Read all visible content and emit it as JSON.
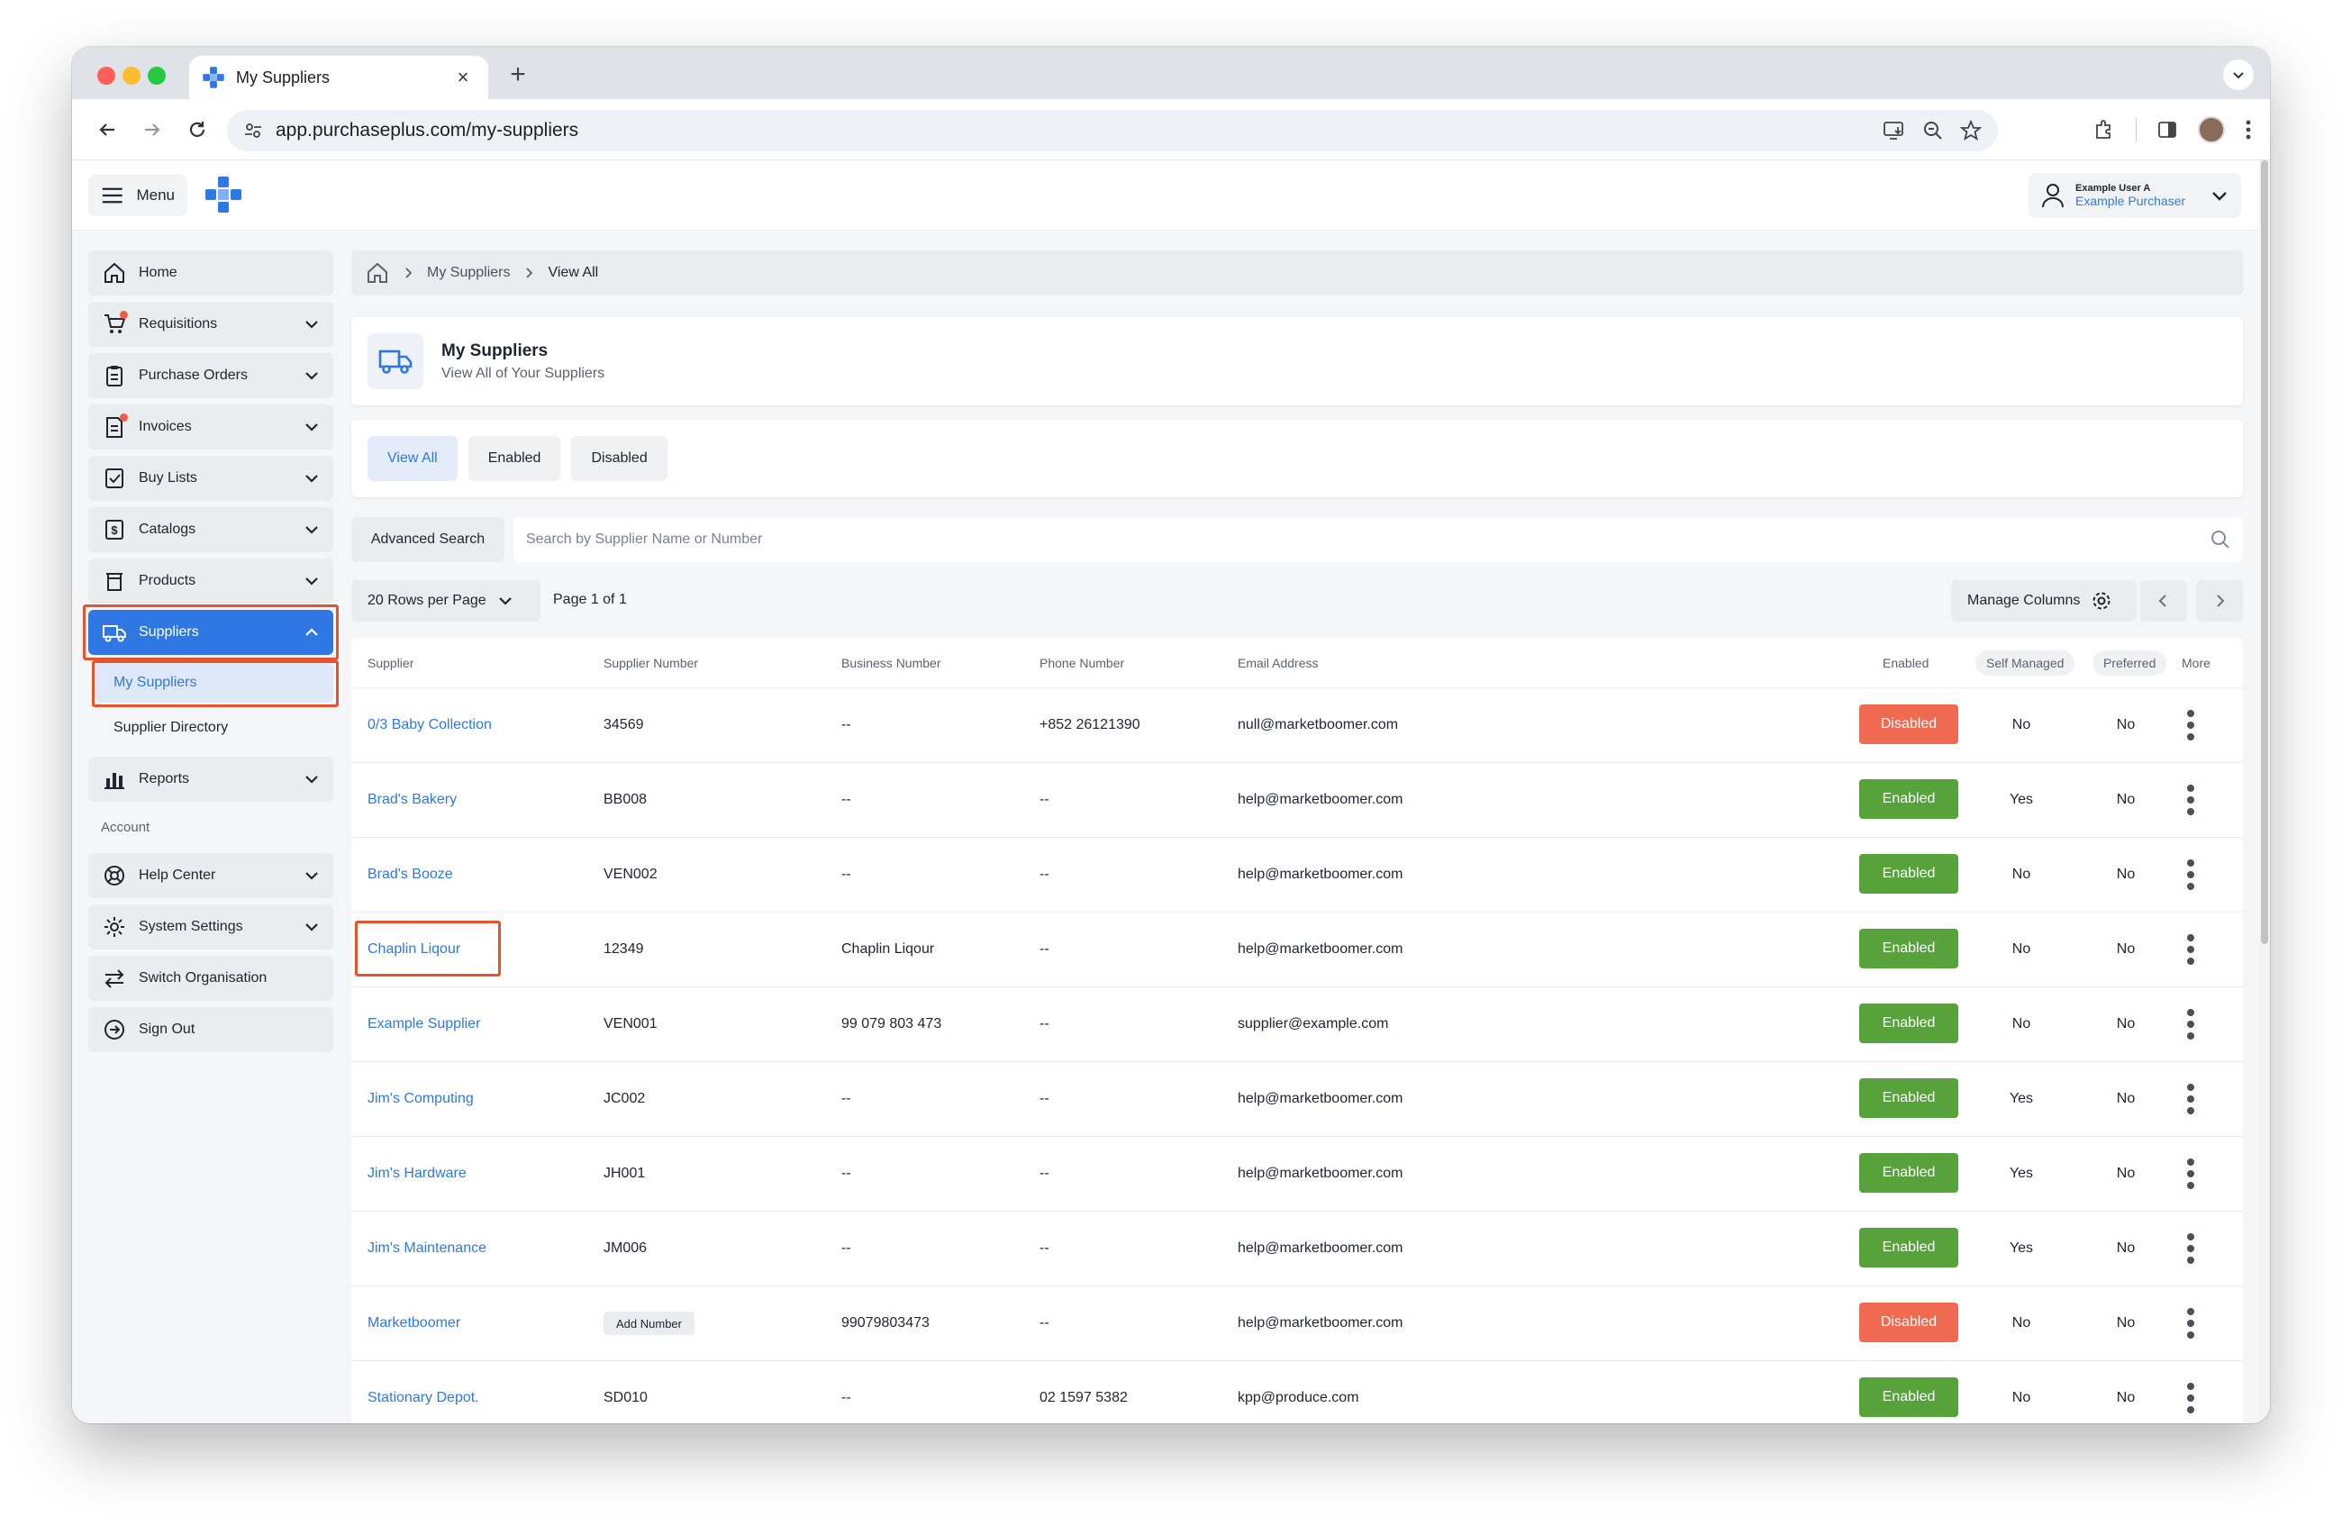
{
  "browser": {
    "tab_title": "My Suppliers",
    "tab_close": "×",
    "new_tab": "+",
    "url": "app.purchaseplus.com/my-suppliers"
  },
  "header": {
    "menu_label": "Menu",
    "user_name": "Example User A",
    "user_role": "Example Purchaser"
  },
  "colors": {
    "accent": "#2f78e4",
    "enabled": "#57a23b",
    "disabled": "#f06a52",
    "highlight": "#e6542e"
  },
  "sidebar": {
    "items": [
      {
        "label": "Home",
        "icon": "home-icon"
      },
      {
        "label": "Requisitions",
        "icon": "cart-icon"
      },
      {
        "label": "Purchase Orders",
        "icon": "clipboard-icon"
      },
      {
        "label": "Invoices",
        "icon": "invoice-icon"
      },
      {
        "label": "Buy Lists",
        "icon": "checklist-icon"
      },
      {
        "label": "Catalogs",
        "icon": "catalog-icon"
      },
      {
        "label": "Products",
        "icon": "products-icon"
      },
      {
        "label": "Suppliers",
        "icon": "truck-icon"
      },
      {
        "label": "Reports",
        "icon": "bar-chart-icon"
      }
    ],
    "sub_items": [
      {
        "label": "My Suppliers"
      },
      {
        "label": "Supplier Directory"
      }
    ],
    "account_section": "Account",
    "account_items": [
      {
        "label": "Help Center",
        "icon": "lifebuoy-icon"
      },
      {
        "label": "System Settings",
        "icon": "gear-icon"
      },
      {
        "label": "Switch Organisation",
        "icon": "switch-icon"
      },
      {
        "label": "Sign Out",
        "icon": "sign-out-icon"
      }
    ]
  },
  "breadcrumb": {
    "level1": "My Suppliers",
    "level2": "View All"
  },
  "title_card": {
    "title": "My Suppliers",
    "subtitle": "View All of Your Suppliers"
  },
  "filters": {
    "tabs": [
      "View All",
      "Enabled",
      "Disabled"
    ],
    "active": "View All"
  },
  "search": {
    "advanced_label": "Advanced Search",
    "placeholder": "Search by Supplier Name or Number"
  },
  "pager": {
    "rows_per_page": "20 Rows per Page",
    "page_info": "Page 1 of 1",
    "manage_columns": "Manage Columns"
  },
  "table": {
    "columns": [
      "Supplier",
      "Supplier Number",
      "Business Number",
      "Phone Number",
      "Email Address",
      "Enabled",
      "Self Managed",
      "Preferred",
      "More"
    ],
    "add_number_label": "Add Number",
    "rows": [
      {
        "supplier": "0/3 Baby Collection",
        "number": "34569",
        "business": "--",
        "phone": "+852 26121390",
        "email": "null@marketboomer.com",
        "status": "Disabled",
        "self_managed": "No",
        "preferred": "No"
      },
      {
        "supplier": "Brad's Bakery",
        "number": "BB008",
        "business": "--",
        "phone": "--",
        "email": "help@marketboomer.com",
        "status": "Enabled",
        "self_managed": "Yes",
        "preferred": "No"
      },
      {
        "supplier": "Brad's Booze",
        "number": "VEN002",
        "business": "--",
        "phone": "--",
        "email": "help@marketboomer.com",
        "status": "Enabled",
        "self_managed": "No",
        "preferred": "No"
      },
      {
        "supplier": "Chaplin Liqour",
        "number": "12349",
        "business": "Chaplin Liqour",
        "phone": "--",
        "email": "help@marketboomer.com",
        "status": "Enabled",
        "self_managed": "No",
        "preferred": "No"
      },
      {
        "supplier": "Example Supplier",
        "number": "VEN001",
        "business": "99 079 803 473",
        "phone": "--",
        "email": "supplier@example.com",
        "status": "Enabled",
        "self_managed": "No",
        "preferred": "No"
      },
      {
        "supplier": "Jim's Computing",
        "number": "JC002",
        "business": "--",
        "phone": "--",
        "email": "help@marketboomer.com",
        "status": "Enabled",
        "self_managed": "Yes",
        "preferred": "No"
      },
      {
        "supplier": "Jim's Hardware",
        "number": "JH001",
        "business": "--",
        "phone": "--",
        "email": "help@marketboomer.com",
        "status": "Enabled",
        "self_managed": "Yes",
        "preferred": "No"
      },
      {
        "supplier": "Jim's Maintenance",
        "number": "JM006",
        "business": "--",
        "phone": "--",
        "email": "help@marketboomer.com",
        "status": "Enabled",
        "self_managed": "Yes",
        "preferred": "No"
      },
      {
        "supplier": "Marketboomer",
        "number": "",
        "business": "99079803473",
        "phone": "--",
        "email": "help@marketboomer.com",
        "status": "Disabled",
        "self_managed": "No",
        "preferred": "No"
      },
      {
        "supplier": "Stationary Depot.",
        "number": "SD010",
        "business": "--",
        "phone": "02 1597 5382",
        "email": "kpp@produce.com",
        "status": "Enabled",
        "self_managed": "No",
        "preferred": "No"
      }
    ]
  }
}
